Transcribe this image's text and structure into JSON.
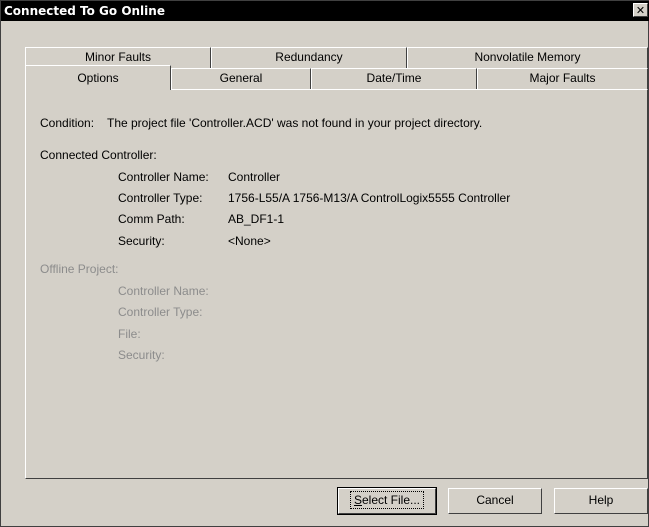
{
  "window": {
    "title": "Connected To Go Online",
    "close_glyph": "✕"
  },
  "tabs": {
    "back_row": [
      {
        "label": "Minor Faults"
      },
      {
        "label": "Redundancy"
      },
      {
        "label": "Nonvolatile Memory"
      }
    ],
    "front_row": [
      {
        "label": "Options",
        "active": true
      },
      {
        "label": "General"
      },
      {
        "label": "Date/Time"
      },
      {
        "label": "Major Faults"
      }
    ]
  },
  "content": {
    "condition_label": "Condition:",
    "condition_text": "The project file 'Controller.ACD' was not found in your project directory.",
    "connected": {
      "heading": "Connected Controller:",
      "name_label": "Controller Name:",
      "name_value": "Controller",
      "type_label": "Controller Type:",
      "type_value": "1756-L55/A 1756-M13/A ControlLogix5555 Controller",
      "path_label": "Comm Path:",
      "path_value": "AB_DF1-1",
      "security_label": "Security:",
      "security_value": "<None>"
    },
    "offline": {
      "heading": "Offline Project:",
      "name_label": "Controller Name:",
      "type_label": "Controller Type:",
      "file_label": "File:",
      "security_label": "Security:"
    }
  },
  "buttons": {
    "select_file_prefix": "",
    "select_file_mnemonic": "S",
    "select_file_rest": "elect File...",
    "cancel": "Cancel",
    "help": "Help"
  }
}
